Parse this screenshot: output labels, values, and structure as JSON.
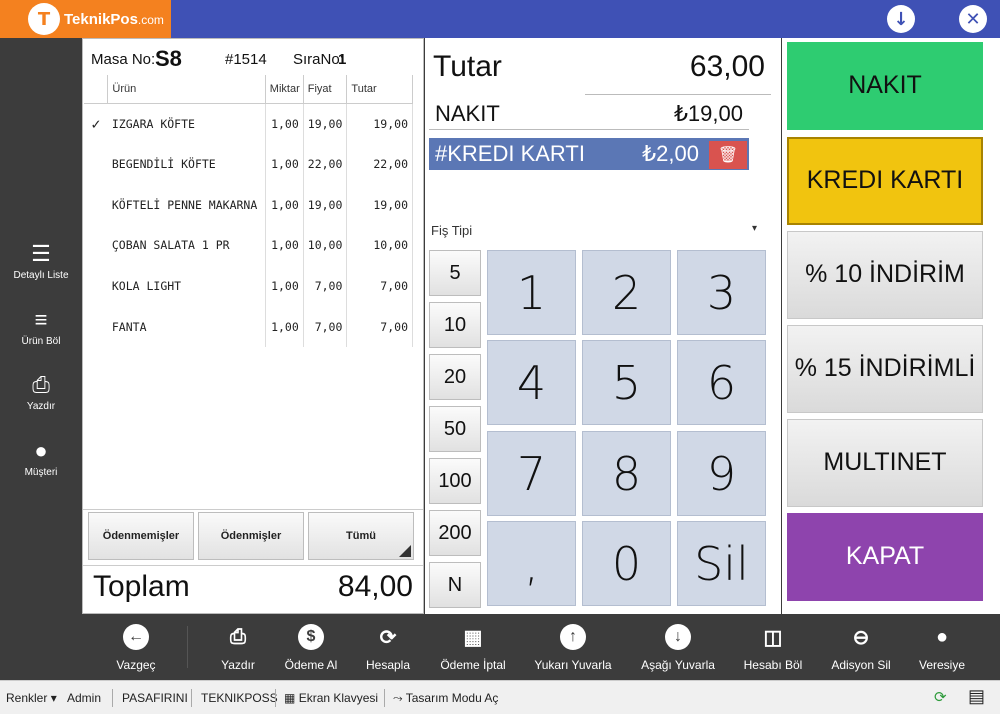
{
  "app": {
    "logo_text": "TeknikPos",
    "logo_suffix": ".com",
    "logo_glyph": "T"
  },
  "top_actions": {
    "download_icon": "download-circle-icon",
    "close_icon": "close-circle-icon",
    "download_glyph": "↓",
    "close_glyph": "✕"
  },
  "sidebar": {
    "items": [
      {
        "label": "Detaylı Liste",
        "icon": "list-detail-icon",
        "glyph": "☰"
      },
      {
        "label": "Ürün Böl",
        "icon": "split-item-icon",
        "glyph": "≡"
      },
      {
        "label": "Yazdır",
        "icon": "printer-icon",
        "glyph": "⎙"
      },
      {
        "label": "Müşteri",
        "icon": "customer-icon",
        "glyph": "●"
      }
    ]
  },
  "order": {
    "masa_label": "Masa No:",
    "masa_value": "S8",
    "order_no": "#1514",
    "sira_label": "SıraNo:",
    "sira_value": "1",
    "columns": [
      "Ürün",
      "Miktar",
      "Fiyat",
      "Tutar"
    ],
    "rows": [
      {
        "check": "✓",
        "name": "IZGARA KÖFTE",
        "qty": "1,00",
        "price": "19,00",
        "total": "19,00"
      },
      {
        "check": "",
        "name": "BEGENDİLİ KÖFTE",
        "qty": "1,00",
        "price": "22,00",
        "total": "22,00"
      },
      {
        "check": "",
        "name": "KÖFTELİ PENNE MAKARNA",
        "qty": "1,00",
        "price": "19,00",
        "total": "19,00"
      },
      {
        "check": "",
        "name": "ÇOBAN SALATA 1 PR",
        "qty": "1,00",
        "price": "10,00",
        "total": "10,00"
      },
      {
        "check": "",
        "name": "KOLA LIGHT",
        "qty": "1,00",
        "price": "7,00",
        "total": "7,00"
      },
      {
        "check": "",
        "name": "FANTA",
        "qty": "1,00",
        "price": "7,00",
        "total": "7,00"
      }
    ],
    "filters": [
      "Ödenmemişler",
      "Ödenmişler",
      "Tümü"
    ],
    "total_label": "Toplam",
    "total_value": "84,00"
  },
  "payment": {
    "tutar_label": "Tutar",
    "tutar_value": "63,00",
    "lines": [
      {
        "label": "NAKIT",
        "amount": "₺19,00"
      },
      {
        "label": "#KREDI KARTI",
        "amount": "₺2,00"
      }
    ],
    "trash_glyph": "🗑",
    "fis_label": "Fiş Tipi",
    "caret": "▾",
    "quick_amounts": [
      "5",
      "10",
      "20",
      "50",
      "100",
      "200",
      "N"
    ],
    "keys": [
      "1",
      "2",
      "3",
      "4",
      "5",
      "6",
      "7",
      "8",
      "9",
      ",",
      "0",
      "Sil"
    ]
  },
  "methods": {
    "buttons": [
      {
        "label": "NAKIT",
        "color": "#2ecc71"
      },
      {
        "label": "KREDI KARTI",
        "color": "#f1c40f"
      },
      {
        "label": "% 10 İNDİRİM",
        "color": "#e4e4e4"
      },
      {
        "label": "% 15 İNDİRİMLİ",
        "color": "#e4e4e4"
      },
      {
        "label": "MULTINET",
        "color": "#e4e4e4"
      },
      {
        "label": "KAPAT",
        "color": "#8e44ad"
      }
    ]
  },
  "actions": {
    "items": [
      {
        "label": "Vazgeç",
        "glyph": "←",
        "icon": "back-icon"
      },
      {
        "label": "Yazdır",
        "glyph": "⎙",
        "icon": "printer-icon"
      },
      {
        "label": "Ödeme Al",
        "glyph": "$",
        "icon": "payment-icon"
      },
      {
        "label": "Hesapla",
        "glyph": "⟳",
        "icon": "refresh-icon"
      },
      {
        "label": "Ödeme İptal",
        "glyph": "▦",
        "icon": "cancel-payment-icon"
      },
      {
        "label": "Yukarı Yuvarla",
        "glyph": "↑",
        "icon": "round-up-icon"
      },
      {
        "label": "Aşağı Yuvarla",
        "glyph": "↓",
        "icon": "round-down-icon"
      },
      {
        "label": "Hesabı Böl",
        "glyph": "◫",
        "icon": "split-bill-icon"
      },
      {
        "label": "Adisyon Sil",
        "glyph": "⊖",
        "icon": "delete-receipt-icon"
      },
      {
        "label": "Veresiye",
        "glyph": "●",
        "icon": "credit-user-icon"
      }
    ]
  },
  "status": {
    "renkler": "Renkler",
    "user": "Admin",
    "location": "PASAFIRINI",
    "brand": "TEKNIKPOSS",
    "keyboard": "Ekran Klavyesi",
    "design": "Tasarım Modu Aç",
    "keyboard_glyph": "▦",
    "design_glyph": "⤳",
    "sync_glyph": "⟳",
    "register_glyph": "▤"
  }
}
